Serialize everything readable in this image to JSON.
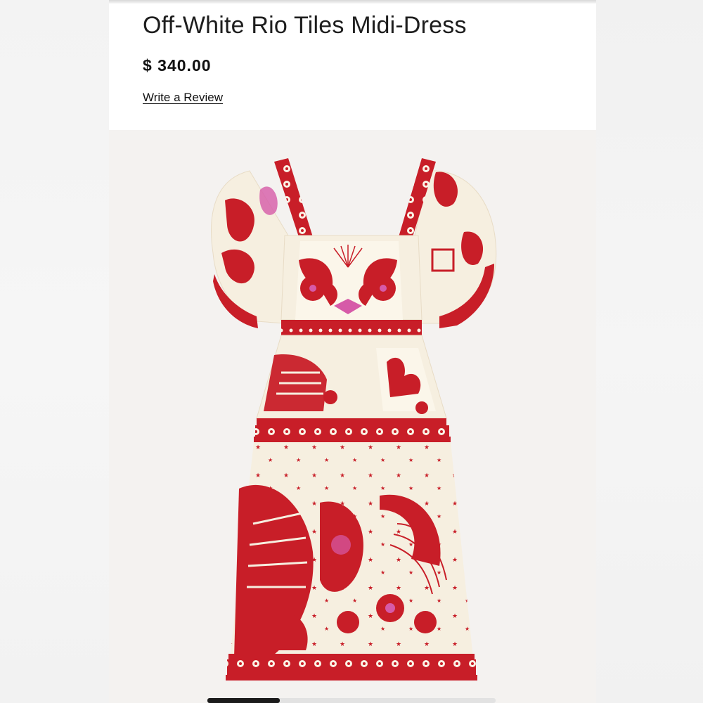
{
  "product": {
    "title": "Off-White Rio Tiles Midi-Dress",
    "price": "$ 340.00",
    "review_link": "Write a Review"
  },
  "image": {
    "alt": "Off-White Rio Tiles Midi-Dress product photo",
    "image_index": 1,
    "image_count": 4,
    "colors": {
      "red": "#c81e28",
      "cream": "#f6efe0",
      "pink": "#d65aa8"
    }
  }
}
